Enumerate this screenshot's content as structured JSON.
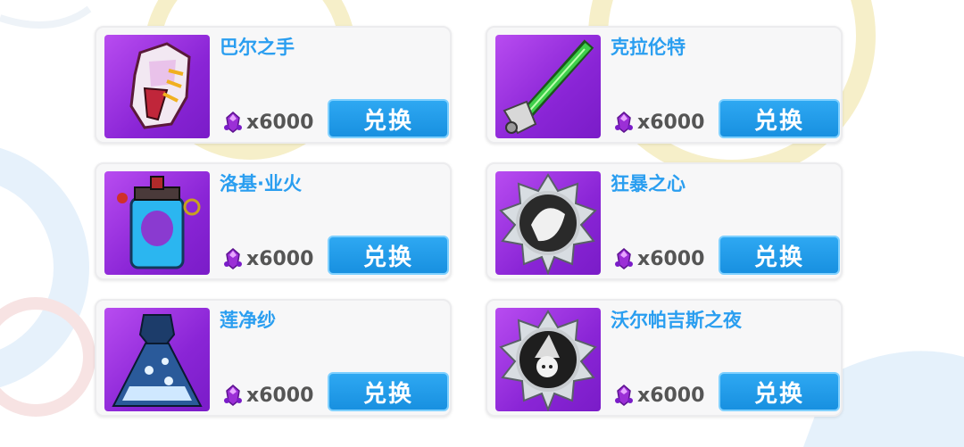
{
  "colors": {
    "name": "#2a9ef0",
    "button": "#1f98e8",
    "price": "#555555",
    "thumb_bg": "#9b36e2"
  },
  "currency_icon": "purple-gem-icon",
  "items": [
    {
      "name": "巴尔之手",
      "price": "x6000",
      "button": "兑换",
      "icon": "claw-gauntlet-icon"
    },
    {
      "name": "克拉伦特",
      "price": "x6000",
      "button": "兑换",
      "icon": "green-sword-icon"
    },
    {
      "name": "洛基·业火",
      "price": "x6000",
      "button": "兑换",
      "icon": "lantern-jar-icon"
    },
    {
      "name": "狂暴之心",
      "price": "x6000",
      "button": "兑换",
      "icon": "silver-medal-icon"
    },
    {
      "name": "莲净纱",
      "price": "x6000",
      "button": "兑换",
      "icon": "blue-dress-icon"
    },
    {
      "name": "沃尔帕吉斯之夜",
      "price": "x6000",
      "button": "兑换",
      "icon": "witch-medal-icon"
    }
  ]
}
